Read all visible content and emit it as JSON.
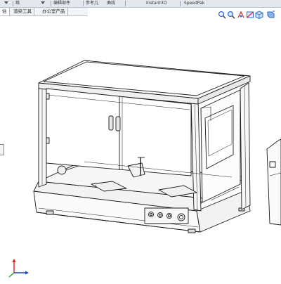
{
  "ribbon": {
    "items": [
      "络",
      "编辑部件",
      "参考几",
      "曲线",
      "Instant3D",
      "SpeedPak"
    ]
  },
  "tabs": {
    "items": [
      "估",
      "渲染工具",
      "办公室产品"
    ],
    "active_index": 0
  },
  "heads_up_toolbar": {
    "icons": [
      "zoom-to-fit-icon",
      "zoom-area-icon",
      "previous-view-icon",
      "section-view-icon",
      "view-orientation-icon",
      "display-style-icon"
    ]
  },
  "colors": {
    "ribbon_bg": "#e4e8ee",
    "viewport_bg": "#ffffff",
    "accent_blue": "#2a6cc6",
    "axis_x": "#d02020",
    "axis_y": "#20a030",
    "axis_z": "#2040d0",
    "line": "#1a1a1a"
  }
}
